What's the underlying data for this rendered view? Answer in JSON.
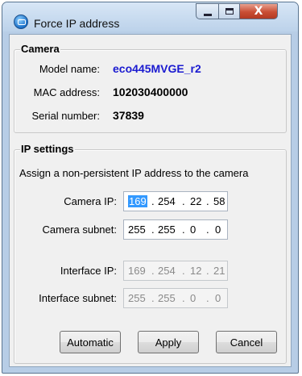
{
  "window": {
    "title": "Force IP address",
    "controls": {
      "minimize": "minimize",
      "maximize": "maximize",
      "close": "X"
    }
  },
  "camera": {
    "group_title": "Camera",
    "model_label": "Model name:",
    "model_value": "eco445MVGE_r2",
    "mac_label": "MAC address:",
    "mac_value": "102030400000",
    "serial_label": "Serial number:",
    "serial_value": "37839"
  },
  "ip_settings": {
    "group_title": "IP settings",
    "description": "Assign a non-persistent IP address to the camera",
    "camera_ip": {
      "label": "Camera IP:",
      "octets": [
        "169",
        "254",
        "22",
        "58"
      ],
      "selected_octet": 0
    },
    "camera_subnet": {
      "label": "Camera subnet:",
      "octets": [
        "255",
        "255",
        "0",
        "0"
      ]
    },
    "interface_ip": {
      "label": "Interface IP:",
      "octets": [
        "169",
        "254",
        "12",
        "21"
      ]
    },
    "interface_subnet": {
      "label": "Interface subnet:",
      "octets": [
        "255",
        "255",
        "0",
        "0"
      ]
    },
    "dot": "."
  },
  "buttons": {
    "automatic": "Automatic",
    "apply": "Apply",
    "cancel": "Cancel"
  },
  "colors": {
    "model_value": "#1a1ad0",
    "selection": "#3399ff",
    "close_button": "#c94e34"
  }
}
